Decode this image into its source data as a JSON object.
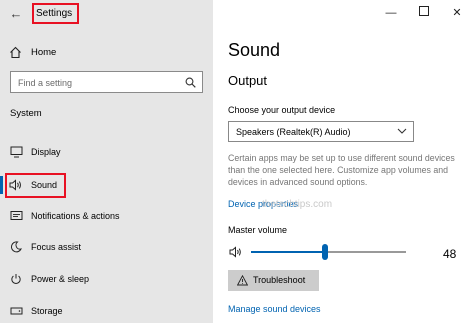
{
  "window": {
    "title": "Settings",
    "back_icon": "back-arrow-icon",
    "controls": [
      "minimize-icon",
      "maximize-icon",
      "close-icon"
    ]
  },
  "sidebar": {
    "home_label": "Home",
    "search_placeholder": "Find a setting",
    "section_title": "System",
    "items": [
      {
        "label": "Display",
        "icon": "display-icon",
        "selected": false
      },
      {
        "label": "Sound",
        "icon": "speaker-icon",
        "selected": true
      },
      {
        "label": "Notifications & actions",
        "icon": "notifications-icon",
        "selected": false
      },
      {
        "label": "Focus assist",
        "icon": "moon-icon",
        "selected": false
      },
      {
        "label": "Power & sleep",
        "icon": "power-icon",
        "selected": false
      },
      {
        "label": "Storage",
        "icon": "storage-icon",
        "selected": false
      }
    ]
  },
  "main": {
    "title": "Sound",
    "output_heading": "Output",
    "choose_label": "Choose your output device",
    "output_device": "Speakers (Realtek(R) Audio)",
    "description": "Certain apps may be set up to use different sound devices than the one selected here. Customize app volumes and devices in advanced sound options.",
    "device_properties_label": "Device properties",
    "watermark": "thetechtips.com",
    "master_volume_label": "Master volume",
    "volume_value": "48",
    "volume_fraction": 0.48,
    "troubleshoot_label": "Troubleshoot",
    "manage_devices_label": "Manage sound devices"
  },
  "colors": {
    "accent": "#0063b1",
    "highlight": "#e81123",
    "sidebar_bg": "#e6e6e6"
  }
}
